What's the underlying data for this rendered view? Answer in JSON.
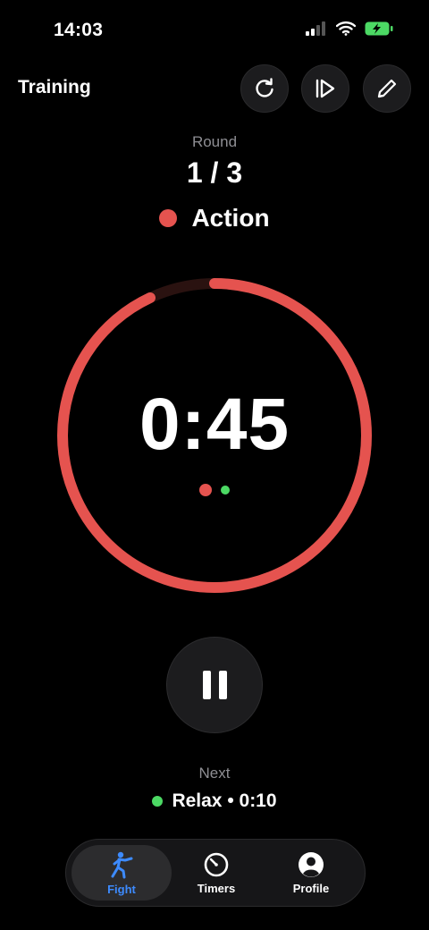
{
  "status_bar": {
    "time": "14:03"
  },
  "header": {
    "title": "Training"
  },
  "round": {
    "label": "Round",
    "value": "1 / 3"
  },
  "phase": {
    "label": "Action",
    "color": "#e5534f"
  },
  "timer": {
    "value": "0:45",
    "progress_fraction": 0.93
  },
  "next": {
    "label": "Next",
    "value": "Relax • 0:10",
    "color": "#4cd964"
  },
  "tabs": [
    {
      "label": "Fight",
      "icon": "fighter-icon",
      "active": true
    },
    {
      "label": "Timers",
      "icon": "timer-icon",
      "active": false
    },
    {
      "label": "Profile",
      "icon": "person-icon",
      "active": false
    }
  ],
  "colors": {
    "accent": "#3d8bff",
    "action": "#e5534f",
    "relax": "#4cd964"
  }
}
